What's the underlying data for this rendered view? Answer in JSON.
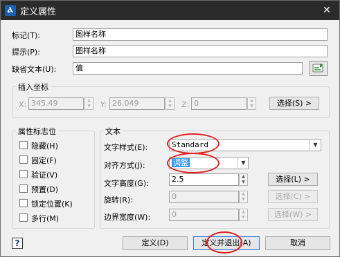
{
  "window": {
    "title": "定义属性",
    "app_icon": "Ⲁ",
    "close": "✕"
  },
  "attr": {
    "tag_label": "标记(T):",
    "tag_value": "图样名称",
    "prompt_label": "提示(P):",
    "prompt_value": "图样名称",
    "default_label": "缺省文本(U):",
    "default_value": "值"
  },
  "insert": {
    "title": "插入坐标",
    "x_label": "X:",
    "x_value": "345.49",
    "y_label": "Y:",
    "y_value": "26.049",
    "z_label": "Z:",
    "z_value": "0",
    "select_btn": "选择(S) >"
  },
  "flags": {
    "title": "属性标志位",
    "items": [
      "隐藏(H)",
      "固定(F)",
      "验证(V)",
      "预置(D)",
      "锁定位置(K)",
      "多行(M)"
    ]
  },
  "text": {
    "title": "文本",
    "style_label": "文字样式(E):",
    "style_value": "Standard",
    "align_label": "对齐方式(J):",
    "align_value": "调整",
    "height_label": "文字高度(G):",
    "height_value": "2.5",
    "rotate_label": "旋转(R):",
    "rotate_value": "0",
    "width_label": "边界宽度(W):",
    "width_value": "0",
    "select_l": "选择(L) >",
    "select_c": "选择(C) >",
    "select_w": "选择(W) >"
  },
  "footer": {
    "help": "?",
    "define": "定义(D)",
    "define_exit": "定义并退出(A)",
    "cancel": "取消"
  },
  "colors": {
    "titlebar": "#2b2b2b",
    "highlight": "#3399ff",
    "annotation": "#e02020"
  }
}
